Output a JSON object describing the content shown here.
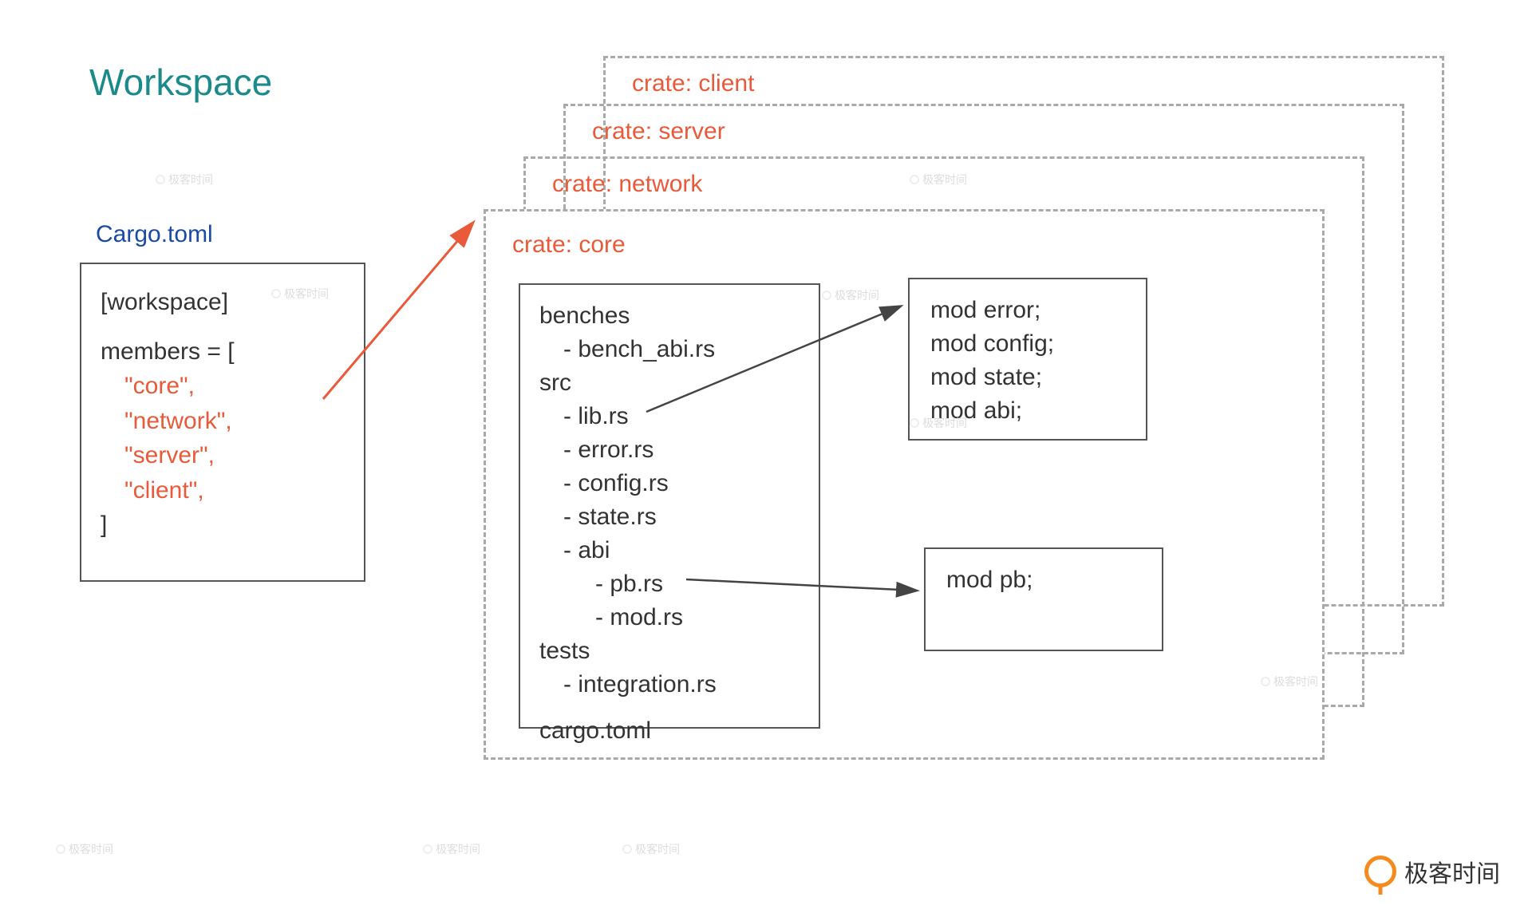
{
  "title": "Workspace",
  "cargo": {
    "label": "Cargo.toml",
    "header": "[workspace]",
    "members_key": "members = [",
    "members": [
      "\"core\",",
      "\"network\",",
      "\"server\",",
      "\"client\","
    ],
    "close": "]"
  },
  "crates": {
    "client": "crate: client",
    "server": "crate: server",
    "network": "crate: network",
    "core": "crate: core"
  },
  "core_files": {
    "l1": "benches",
    "l2": "- bench_abi.rs",
    "l3": "src",
    "l4": "- lib.rs",
    "l5": "- error.rs",
    "l6": "- config.rs",
    "l7": "- state.rs",
    "l8": "- abi",
    "l9": "- pb.rs",
    "l10": "- mod.rs",
    "l11": "tests",
    "l12": "- integration.rs",
    "l13": "cargo.toml"
  },
  "lib_mods": {
    "m1": "mod error;",
    "m2": "mod config;",
    "m3": "mod state;",
    "m4": "mod abi;"
  },
  "abi_mods": {
    "m1": "mod pb;"
  },
  "footer": "极客时间",
  "watermark": "极客时间"
}
